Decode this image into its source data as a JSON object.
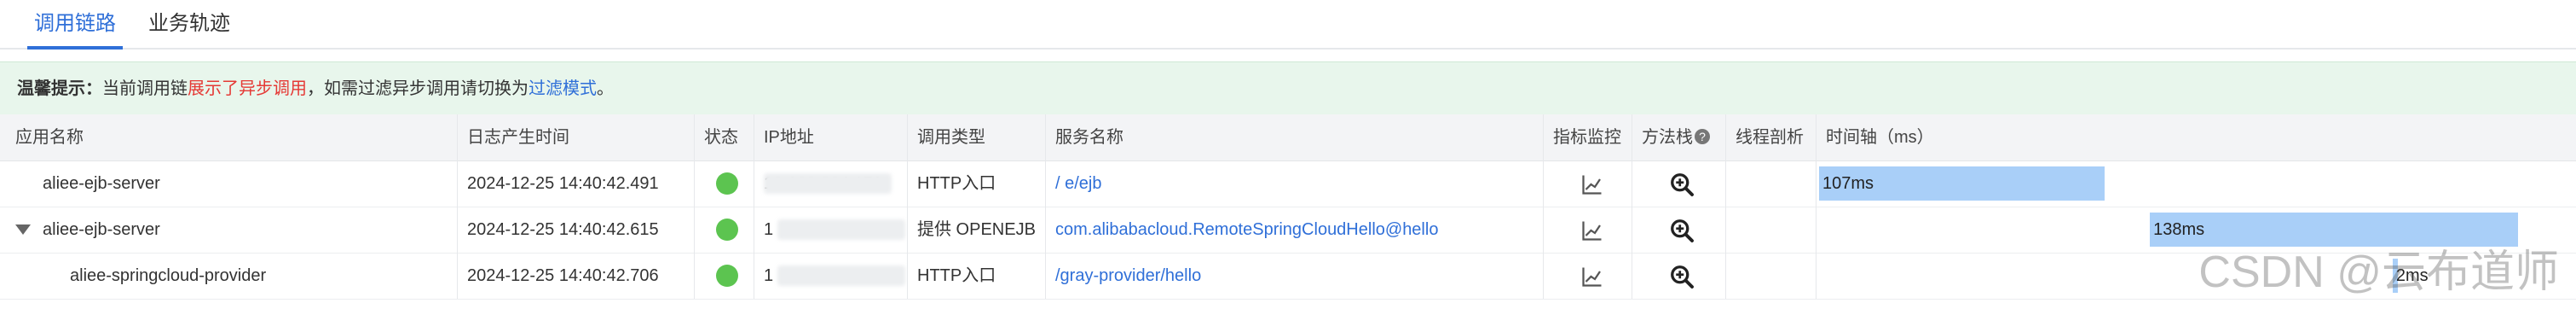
{
  "tabs": [
    {
      "label": "调用链路",
      "active": true
    },
    {
      "label": "业务轨迹",
      "active": false
    }
  ],
  "tip": {
    "prefix": "温馨提示：",
    "text1": "当前调用链",
    "red": "展示了异步调用",
    "text2": "，如需过滤异步调用请切换为",
    "link": "过滤模式",
    "text3": "。"
  },
  "columns": {
    "app": "应用名称",
    "time": "日志产生时间",
    "status": "状态",
    "ip": "IP地址",
    "type": "调用类型",
    "service": "服务名称",
    "metrics": "指标监控",
    "stack": "方法栈",
    "profiling": "线程剖析",
    "timeline": "时间轴（ms）"
  },
  "rows": [
    {
      "app": "aliee-ejb-server",
      "time": "2024-12-25 14:40:42.491",
      "status": "ok",
      "ip": "10.100.204.171",
      "type": "HTTP入口",
      "service": "/        e/ejb",
      "duration": "107ms",
      "start": 0,
      "length": 107,
      "expandable": false
    },
    {
      "app": "aliee-ejb-server",
      "time": "2024-12-25 14:40:42.615",
      "status": "ok",
      "ip": "1",
      "type": "提供 OPENEJB",
      "service": "com.alibabacloud.RemoteSpringCloudHello@hello",
      "duration": "138ms",
      "start": 124,
      "length": 138,
      "expandable": true
    },
    {
      "app": "aliee-springcloud-provider",
      "time": "2024-12-25 14:40:42.706",
      "status": "ok",
      "ip": "1",
      "type": "HTTP入口",
      "service": "/gray-provider/hello",
      "duration": "2ms",
      "start": 215,
      "length": 2,
      "expandable": false
    }
  ],
  "timeline_total_ms": 262,
  "watermark": "CSDN @云布道师",
  "colors": {
    "accent": "#2f6fd8",
    "status_ok": "#5cc450",
    "bar": "#a9cff8",
    "tip_bg": "#e8f6ec"
  },
  "icons": {
    "metrics": "line-chart-icon",
    "stack": "zoom-in-icon",
    "help": "question-circle-icon",
    "expand": "caret-down-icon"
  }
}
